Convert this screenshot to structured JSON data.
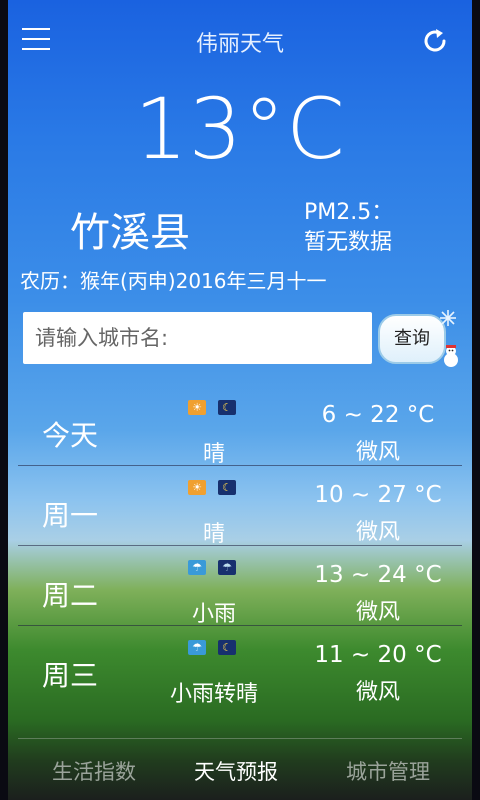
{
  "header": {
    "title": "伟丽天气"
  },
  "current": {
    "temperature": "13°C",
    "county": "竹溪县",
    "pm_label": "PM2.5：",
    "pm_value": "暂无数据",
    "lunar": "农历：猴年(丙申)2016年三月十一"
  },
  "search": {
    "placeholder": "请输入城市名:",
    "button_label": "查询"
  },
  "forecast": [
    {
      "day": "今天",
      "condition": "晴",
      "temps": "6 ~ 22 °C",
      "wind": "微风",
      "icons": [
        "sun-icon",
        "moon-icon"
      ]
    },
    {
      "day": "周一",
      "condition": "晴",
      "temps": "10 ~ 27 °C",
      "wind": "微风",
      "icons": [
        "sun-icon",
        "moon-icon"
      ]
    },
    {
      "day": "周二",
      "condition": "小雨",
      "temps": "13 ~ 24 °C",
      "wind": "微风",
      "icons": [
        "rain-icon",
        "rain-night-icon"
      ]
    },
    {
      "day": "周三",
      "condition": "小雨转晴",
      "temps": "11 ~ 20 °C",
      "wind": "微风",
      "icons": [
        "rain-icon",
        "moon-icon"
      ]
    }
  ],
  "tabs": {
    "life": "生活指数",
    "forecast": "天气预报",
    "city": "城市管理"
  }
}
